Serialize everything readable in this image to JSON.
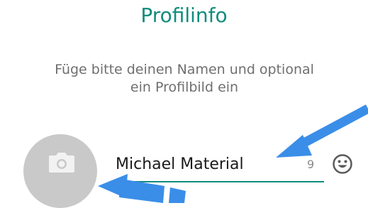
{
  "header": {
    "title": "Profilinfo"
  },
  "intro": {
    "text": "Füge bitte deinen Namen und optional ein Profilbild ein"
  },
  "profile": {
    "name_value": "Michael Material",
    "char_counter": "9"
  },
  "colors": {
    "accent": "#128C7E",
    "annotation": "#3a8ee8",
    "avatar_bg": "#c9c9c9"
  },
  "icons": {
    "avatar": "camera-icon",
    "emoji": "emoji-smiley-icon"
  }
}
